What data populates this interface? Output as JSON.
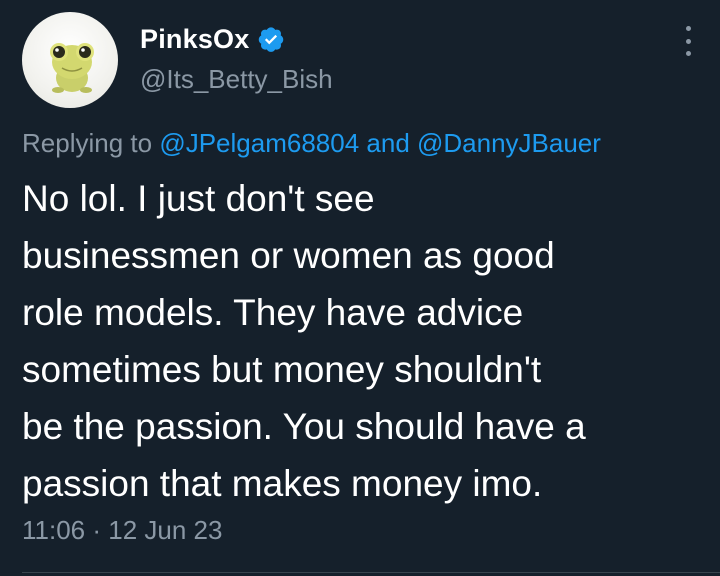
{
  "author": {
    "display_name": "PinksOx",
    "handle": "@Its_Betty_Bish",
    "verified": true,
    "avatar": "frog-avatar"
  },
  "reply": {
    "prefix": "Replying to ",
    "mention_1": "@JPelgam68804",
    "conjunction": " and ",
    "mention_2": "@DannyJBauer"
  },
  "tweet": {
    "text_lines": [
      "No lol. I just don't see",
      "businessmen or women as good",
      "role models. They have advice",
      "sometimes but money shouldn't",
      "be the passion. You should have a",
      "passion that makes money imo."
    ],
    "timestamp": "11:06 · 12 Jun 23"
  },
  "icons": {
    "verified": "verified-badge-icon",
    "more": "more-options-icon"
  },
  "colors": {
    "background": "#15202b",
    "accent": "#1d9bf0",
    "secondary_text": "#8b98a5"
  }
}
